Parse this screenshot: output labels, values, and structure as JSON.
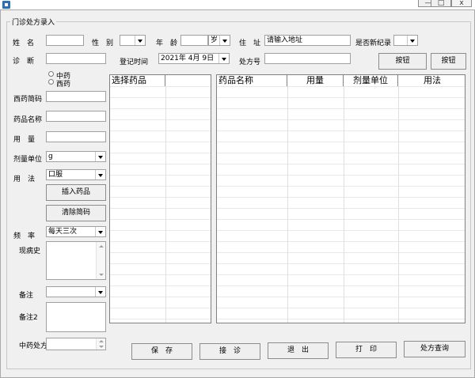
{
  "window": {
    "title": "门诊处方录入",
    "controls": {
      "minimize": "—",
      "maximize": "□",
      "close": "x"
    }
  },
  "form": {
    "name_label": "姓　名",
    "name_value": "",
    "gender_label": "性　别",
    "gender_value": "",
    "age_label": "年　龄",
    "age_value": "",
    "age_unit": "岁",
    "address_label": "住　址",
    "address_value": "请输入地址",
    "is_new_label": "是否新纪录",
    "is_new_value": "",
    "diagnosis_label": "诊　断",
    "diagnosis_value": "",
    "register_time_label": "登记时间",
    "register_time_value": "2021年 4月 9日",
    "prescription_no_label": "处方号",
    "prescription_no_value": "",
    "button1_label": "按钮",
    "button2_label": "按钮",
    "radio_chinese_label": "中药",
    "radio_western_label": "西药",
    "western_code_label": "西药简码",
    "western_code_value": "",
    "drug_name_label": "药品名称",
    "drug_name_value": "",
    "dosage_label": "用　量",
    "dosage_value": "",
    "dose_unit_label": "剂量单位",
    "dose_unit_value": "g",
    "usage_label": "用　法",
    "usage_value": "口服",
    "insert_drug_label": "插入药品",
    "clear_code_label": "清除简码",
    "frequency_label": "频　率",
    "frequency_value": "每天三次",
    "history_label": "现病史",
    "note_label": "备注",
    "note_value": "",
    "note2_label": "备注2",
    "tcm_prescription_label": "中药处方"
  },
  "select_grid": {
    "columns": [
      "选择药品",
      ""
    ]
  },
  "drug_grid": {
    "columns": [
      "药品名称",
      "用量",
      "剂量单位",
      "用法"
    ]
  },
  "actions": {
    "save": "保　存",
    "receive": "接　诊",
    "exit": "退　出",
    "print": "打　印",
    "query": "处方查询"
  }
}
